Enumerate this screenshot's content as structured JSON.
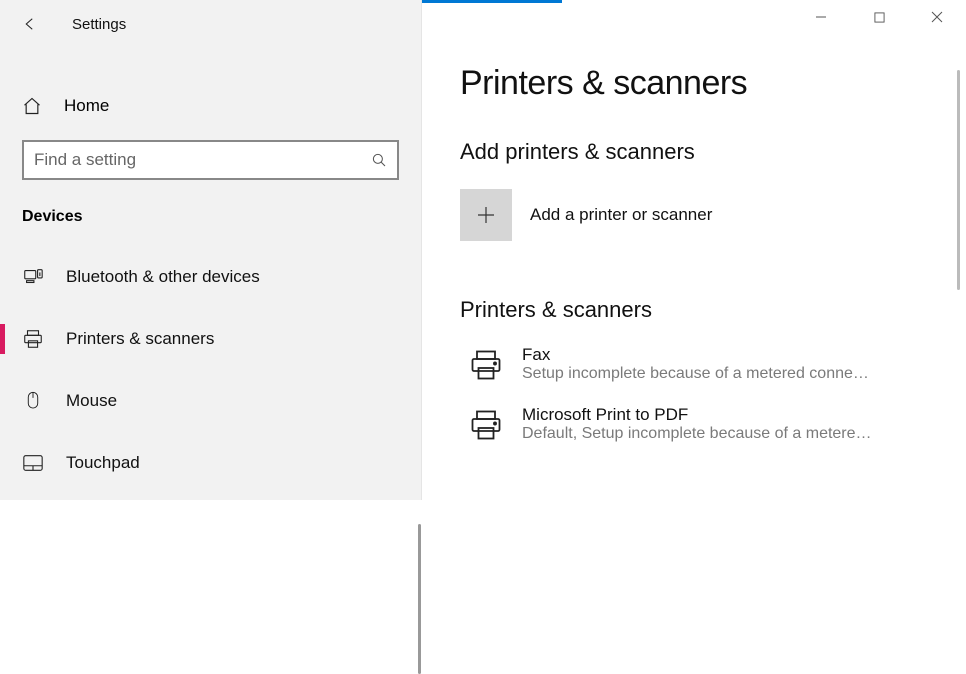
{
  "header": {
    "app_title": "Settings"
  },
  "home_label": "Home",
  "search": {
    "placeholder": "Find a setting"
  },
  "category_label": "Devices",
  "nav": [
    {
      "label": "Bluetooth & other devices",
      "selected": false
    },
    {
      "label": "Printers & scanners",
      "selected": true
    },
    {
      "label": "Mouse",
      "selected": false
    },
    {
      "label": "Touchpad",
      "selected": false
    }
  ],
  "main": {
    "page_title": "Printers & scanners",
    "section_add_title": "Add printers & scanners",
    "add_label": "Add a printer or scanner",
    "section_list_title": "Printers & scanners",
    "devices": [
      {
        "name": "Fax",
        "sub": "Setup incomplete because of a metered conne…"
      },
      {
        "name": "Microsoft Print to PDF",
        "sub": "Default, Setup incomplete because of a metere…"
      }
    ]
  }
}
